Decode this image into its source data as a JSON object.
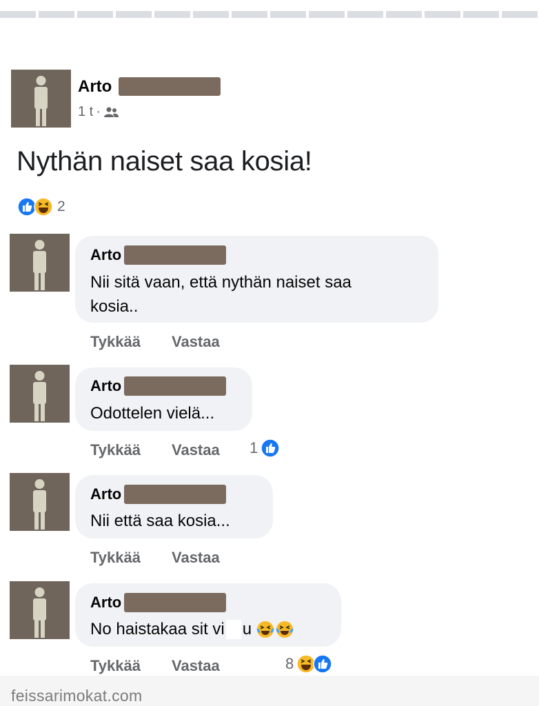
{
  "post": {
    "author": "Arto",
    "time": "1 t",
    "separator": "·",
    "audience_icon": "friends-icon",
    "text": "Nythän naiset saa kosia!",
    "reactions": [
      "like-reaction-icon",
      "haha-reaction-icon"
    ],
    "reaction_count": "2"
  },
  "comments": [
    {
      "author": "Arto",
      "text_line1": "Nii sitä vaan, että nythän naiset saa",
      "text_line2": "kosia..",
      "like_label": "Tykkää",
      "reply_label": "Vastaa"
    },
    {
      "author": "Arto",
      "text_line1": "Odottelen vielä...",
      "like_label": "Tykkää",
      "reply_label": "Vastaa",
      "reaction_count": "1",
      "reactions": [
        "like-reaction-icon"
      ]
    },
    {
      "author": "Arto",
      "text_line1": "Nii että saa kosia...",
      "like_label": "Tykkää",
      "reply_label": "Vastaa"
    },
    {
      "author": "Arto",
      "text_line1": "No haistakaa sit vi",
      "text_tail": "u",
      "text_emoji": [
        "tears-of-joy-emoji",
        "tears-of-joy-emoji"
      ],
      "like_label": "Tykkää",
      "reply_label": "Vastaa",
      "reaction_count": "8",
      "reactions": [
        "haha-reaction-icon",
        "like-reaction-icon"
      ]
    }
  ],
  "watermark": "feissarimokat.com",
  "colors": {
    "like_blue": "#1877f2",
    "haha_yellow": "#f7b928",
    "bubble_bg": "#f0f2f5",
    "redaction": "#7b6a5e",
    "avatar_bg": "#6f655b"
  }
}
